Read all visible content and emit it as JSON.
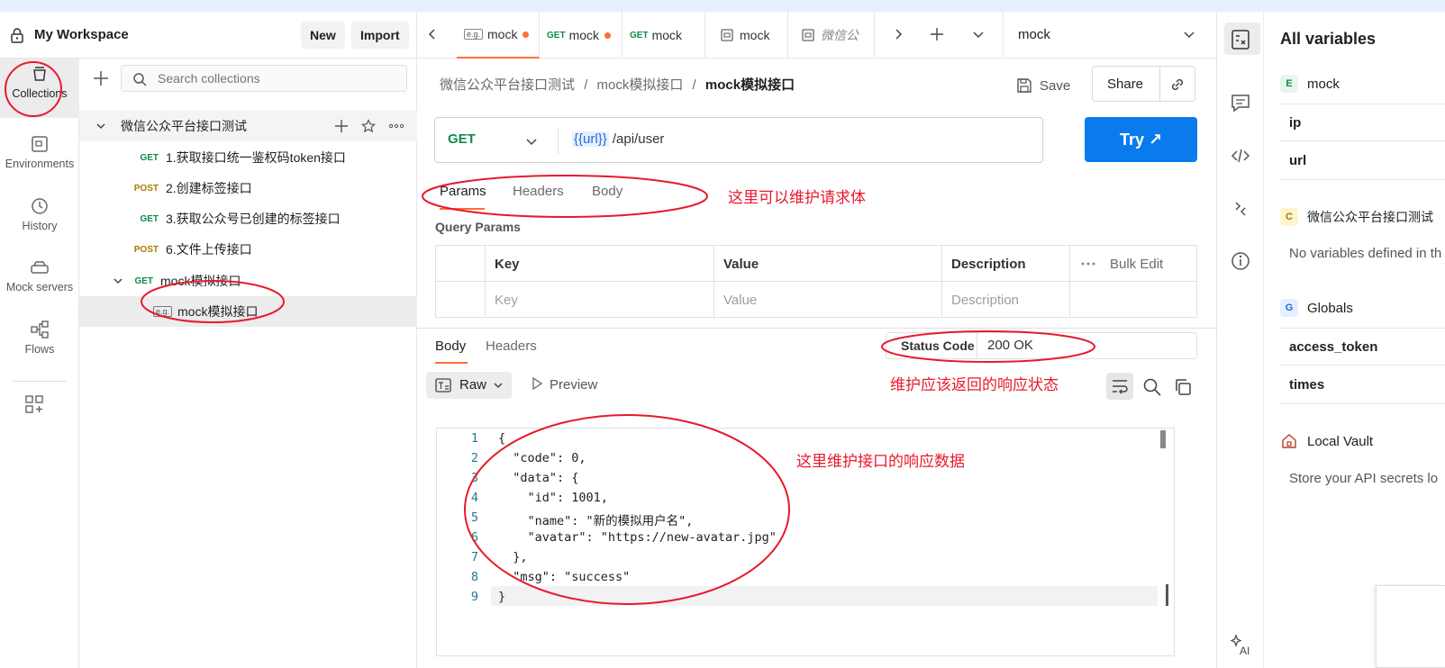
{
  "workspace": {
    "title": "My Workspace",
    "new_label": "New",
    "import_label": "Import"
  },
  "rail": [
    {
      "label": "Collections",
      "icon": "collections-icon"
    },
    {
      "label": "Environments",
      "icon": "environments-icon"
    },
    {
      "label": "History",
      "icon": "history-icon"
    },
    {
      "label": "Mock servers",
      "icon": "mock-servers-icon"
    },
    {
      "label": "Flows",
      "icon": "flows-icon"
    }
  ],
  "collections": {
    "search_placeholder": "Search collections",
    "root": "微信公众平台接口测试",
    "items": [
      {
        "method": "GET",
        "name": "1.获取接口统一鉴权码token接口"
      },
      {
        "method": "POST",
        "name": "2.创建标签接口"
      },
      {
        "method": "GET",
        "name": "3.获取公众号已创建的标签接口"
      },
      {
        "method": "POST",
        "name": "6.文件上传接口"
      },
      {
        "method": "GET",
        "name": "mock模拟接口"
      }
    ],
    "example": {
      "badge": "e.g.",
      "name": "mock模拟接口"
    }
  },
  "tabs": [
    {
      "badge": "e.g.",
      "label": "mock"
    },
    {
      "method": "GET",
      "label": "mock"
    },
    {
      "method": "GET",
      "label": "mock"
    },
    {
      "label": "mock"
    },
    {
      "label": "微信公"
    }
  ],
  "env_select": "mock",
  "breadcrumb": {
    "part1": "微信公众平台接口测试",
    "part2": "mock模拟接口",
    "current": "mock模拟接口"
  },
  "actions": {
    "save": "Save",
    "share": "Share"
  },
  "request": {
    "method": "GET",
    "url_var": "{{url}}",
    "url_path": " /api/user",
    "try": "Try ↗",
    "tabs": [
      "Params",
      "Headers",
      "Body"
    ],
    "query_params_title": "Query Params",
    "columns": [
      "Key",
      "Value",
      "Description"
    ],
    "bulk_edit": "Bulk Edit",
    "placeholders": [
      "Key",
      "Value",
      "Description"
    ]
  },
  "response": {
    "tabs": [
      "Body",
      "Headers"
    ],
    "status_label": "Status Code",
    "status_value": "200 OK",
    "format": "Raw",
    "preview": "Preview",
    "lines": [
      "{",
      "  \"code\": 0,",
      "  \"data\": {",
      "    \"id\": 1001,",
      "    \"name\": \"新的模拟用户名\",",
      "    \"avatar\": \"https://new-avatar.jpg\"",
      "  },",
      "  \"msg\": \"success\"",
      "}"
    ]
  },
  "variables": {
    "title": "All variables",
    "env_name": "mock",
    "env_vars": [
      "ip",
      "url"
    ],
    "collection_name": "微信公众平台接口测试",
    "collection_note": "No variables defined in th",
    "globals_name": "Globals",
    "global_vars": [
      "access_token",
      "times"
    ],
    "vault_name": "Local Vault",
    "vault_note": "Store your API secrets lo"
  },
  "annotations": {
    "params": "这里可以维护请求体",
    "status": "维护应该返回的响应状态",
    "body": "这里维护接口的响应数据"
  },
  "colors": {
    "accent": "#ff6c37",
    "primary": "#097bed",
    "get": "#0f8a4c",
    "post": "#ad7a03",
    "annotation": "#e8192c"
  }
}
